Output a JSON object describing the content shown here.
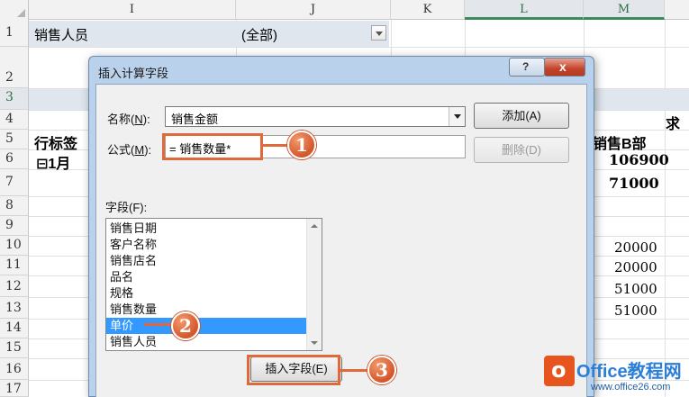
{
  "sheet": {
    "columns": [
      "I",
      "J",
      "K",
      "L",
      "M"
    ],
    "rows": [
      "1",
      "2",
      "3",
      "4",
      "5",
      "6",
      "7",
      "8",
      "9",
      "10",
      "11",
      "12",
      "13",
      "14",
      "15",
      "16",
      "17"
    ],
    "cells": {
      "r1_label": "销售人员",
      "r1_value": "(全部)",
      "r4_qiu": "求",
      "r5_row_label": "行标签",
      "r5_header": "销售B部",
      "r6_month": "⊟1月",
      "r6_value": "106900",
      "r7_value": "71000",
      "r10_value": "20000",
      "r11_value": "20000",
      "r12_value": "51000",
      "r13_value": "51000"
    }
  },
  "dialog": {
    "title": "插入计算字段",
    "help_glyph": "?",
    "close_glyph": "x",
    "name_label_prefix": "名称(",
    "name_label_key": "N",
    "name_label_suffix": "):",
    "name_value": "销售金额",
    "formula_label_prefix": "公式(",
    "formula_label_key": "M",
    "formula_label_suffix": "):",
    "formula_value": "= 销售数量*",
    "add_button": "添加(A)",
    "delete_button": "删除(D)",
    "fields_label": "字段(F):",
    "fields": [
      "销售日期",
      "客户名称",
      "销售店名",
      "品名",
      "规格",
      "销售数量",
      "单价",
      "销售人员"
    ],
    "selected_field_index": 6,
    "insert_field_button": "插入字段(E)"
  },
  "callouts": [
    "1",
    "2",
    "3"
  ],
  "watermark": {
    "logo_letter": "o",
    "title": "Office教程网",
    "url": "www.office26.com"
  },
  "colors": {
    "accent_orange": "#e0693b",
    "selection_blue": "#3399ff",
    "dialog_frame": "#b9d1ea"
  }
}
